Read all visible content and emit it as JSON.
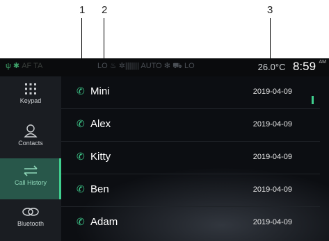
{
  "callouts": [
    "1",
    "2",
    "3"
  ],
  "status": {
    "icons_left": [
      "usb-icon",
      "bluetooth-icon"
    ],
    "af": "AF",
    "ta": "TA",
    "fan_left": "LO",
    "auto": "AUTO",
    "fan_right": "LO",
    "temperature": "26.0°C",
    "time": "8:59",
    "ampm": "AM"
  },
  "sidebar": {
    "items": [
      {
        "label": "Keypad",
        "icon": "keypad-icon"
      },
      {
        "label": "Contacts",
        "icon": "contacts-icon"
      },
      {
        "label": "Call History",
        "icon": "call-history-icon",
        "active": true
      },
      {
        "label": "Bluetooth",
        "icon": "bluetooth-link-icon"
      }
    ]
  },
  "calls": [
    {
      "name": "Mini",
      "date": "2019-04-09"
    },
    {
      "name": "Alex",
      "date": "2019-04-09"
    },
    {
      "name": "Kitty",
      "date": "2019-04-09"
    },
    {
      "name": "Ben",
      "date": "2019-04-09"
    },
    {
      "name": "Adam",
      "date": "2019-04-09"
    }
  ],
  "colors": {
    "accent": "#3fcf8e",
    "active_bg": "#28574a",
    "sidebar": "#1a1d22",
    "background": "#0c0e12"
  }
}
